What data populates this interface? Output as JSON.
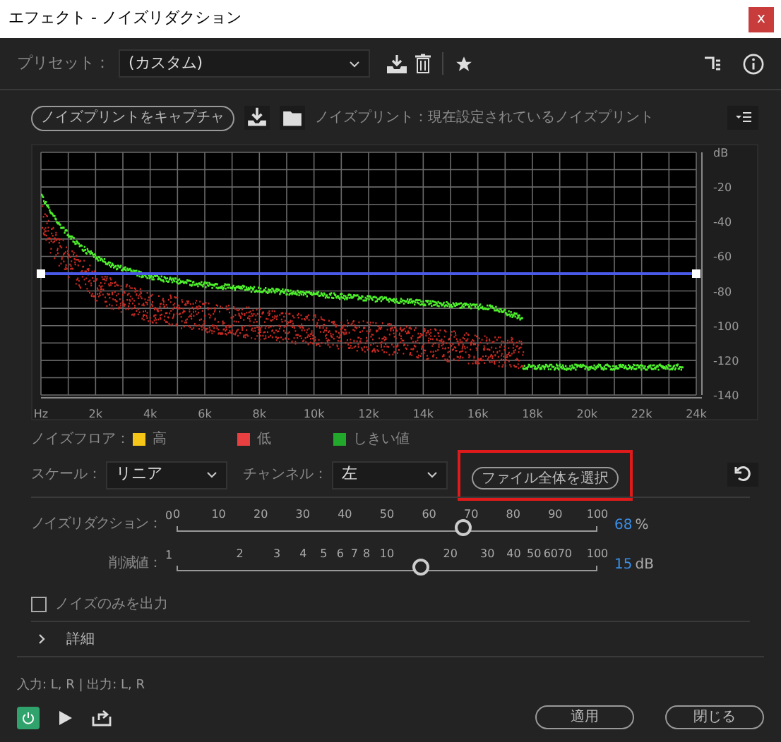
{
  "window": {
    "title": "エフェクト - ノイズリダクション",
    "close": "x"
  },
  "preset": {
    "label": "プリセット：",
    "value": "(カスタム)"
  },
  "noiseprint": {
    "capture_button": "ノイズプリントをキャプチャ",
    "label": "ノイズプリント：現在設定されているノイズプリント"
  },
  "graph": {
    "y_unit": "dB",
    "y_labels": [
      "-20",
      "-40",
      "-60",
      "-80",
      "-100",
      "-120",
      "-140"
    ],
    "x_labels": [
      "Hz",
      "2k",
      "4k",
      "6k",
      "8k",
      "10k",
      "12k",
      "14k",
      "16k",
      "18k",
      "20k",
      "22k",
      "24k"
    ]
  },
  "legend": {
    "label": "ノイズフロア：",
    "items": [
      {
        "label": "高",
        "color": "#f5c518"
      },
      {
        "label": "低",
        "color": "#e84040"
      },
      {
        "label": "しきい値",
        "color": "#22a82a"
      }
    ]
  },
  "scale": {
    "label": "スケール：",
    "value": "リニア"
  },
  "channel": {
    "label": "チャンネル：",
    "value": "左"
  },
  "select_whole_file": {
    "label": "ファイル全体を選択",
    "highlighted": true
  },
  "sliders": [
    {
      "label": "ノイズリダクション：",
      "kind": "linear",
      "min_label": "0",
      "ticks": [
        "0",
        "10",
        "20",
        "30",
        "40",
        "50",
        "60",
        "70",
        "80",
        "90",
        "100"
      ],
      "level": 0.68,
      "value": "68",
      "unit": "%"
    },
    {
      "label": "削減値：",
      "kind": "log",
      "min_label": "1",
      "ticks": [
        "2",
        "3",
        "4",
        "5",
        "6",
        "7",
        "8",
        "10",
        "20",
        "30",
        "40",
        "50",
        "60",
        "70",
        "100"
      ],
      "level": 0.58,
      "value": "15",
      "unit": "dB"
    }
  ],
  "noise_only": {
    "label": "ノイズのみを出力",
    "checked": false
  },
  "details": {
    "label": "詳細",
    "expanded": false
  },
  "io": "入力: L, R | 出力: L, R",
  "power": {
    "on": true
  },
  "buttons": [
    "適用",
    "閉じる"
  ]
}
